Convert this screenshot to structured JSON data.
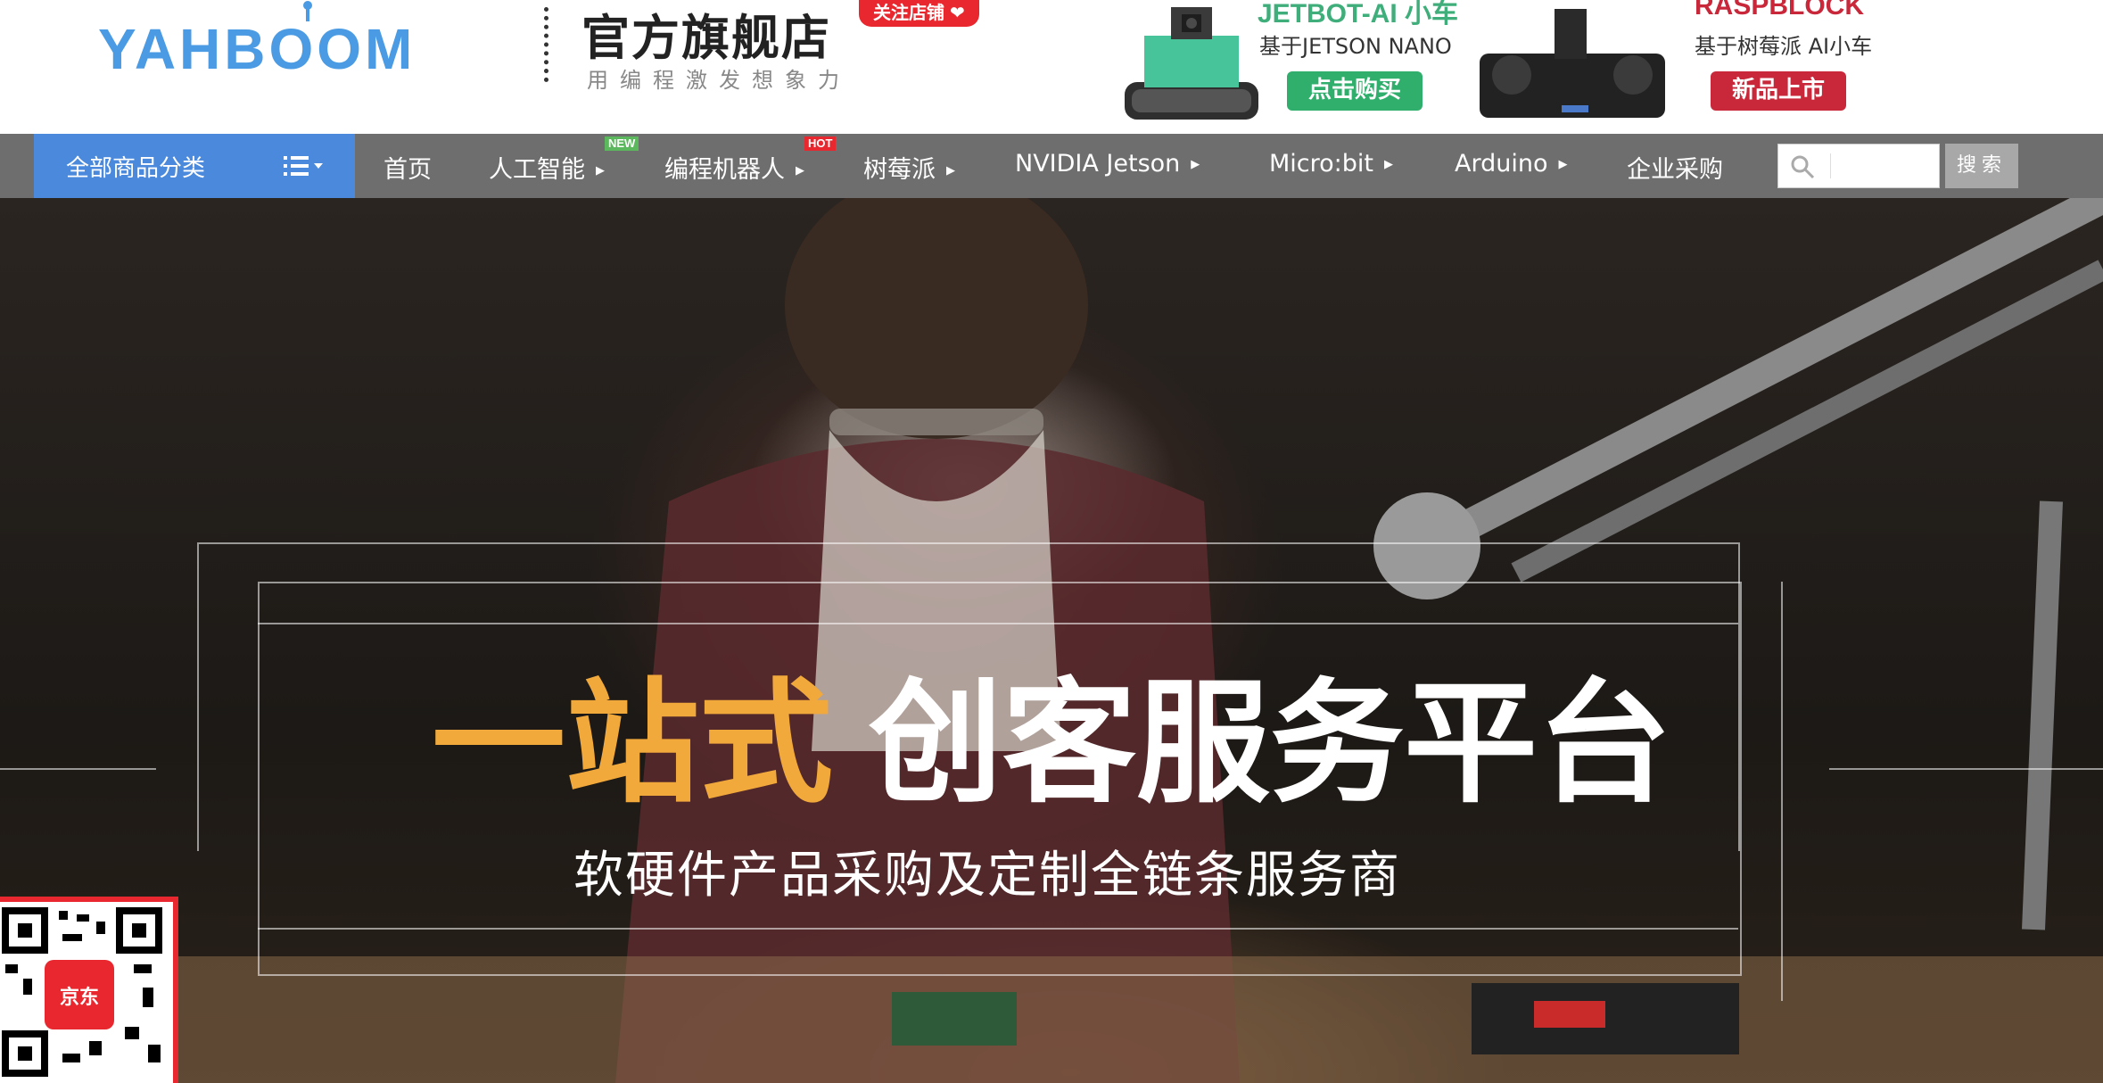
{
  "header": {
    "logo_text": "YAHBOOM",
    "shop_name": "官方旗舰店",
    "slogan": "用编程激发想象力",
    "follow_label": "关注店铺",
    "promos": [
      {
        "title": "JETBOT-AI 小车",
        "subtitle": "基于JETSON NANO",
        "button": "点击购买",
        "title_color": "#3fae7a",
        "button_color": "#2fae6c"
      },
      {
        "title": "RASPBLOCK",
        "subtitle": "基于树莓派 AI小车",
        "button": "新品上市",
        "title_color": "#c8283a",
        "button_color": "#c8283a"
      }
    ]
  },
  "nav": {
    "all_categories": "全部商品分类",
    "items": [
      {
        "label": "首页",
        "caret": false
      },
      {
        "label": "人工智能",
        "caret": true,
        "tag": "NEW",
        "tag_color": "#5cb85c"
      },
      {
        "label": "编程机器人",
        "caret": true,
        "tag": "HOT",
        "tag_color": "#e8282e"
      },
      {
        "label": "树莓派",
        "caret": true
      },
      {
        "label": "NVIDIA Jetson",
        "caret": true
      },
      {
        "label": "Micro:bit",
        "caret": true
      },
      {
        "label": "Arduino",
        "caret": true
      },
      {
        "label": "企业采购",
        "caret": false
      }
    ],
    "search_placeholder": "",
    "search_button": "搜索"
  },
  "hero": {
    "title_highlight": "一站式",
    "title_rest": "创客服务平台",
    "subtitle": "软硬件产品采购及定制全链条服务商",
    "highlight_color": "#f2a93b"
  },
  "qr": {
    "brand": "京东"
  }
}
